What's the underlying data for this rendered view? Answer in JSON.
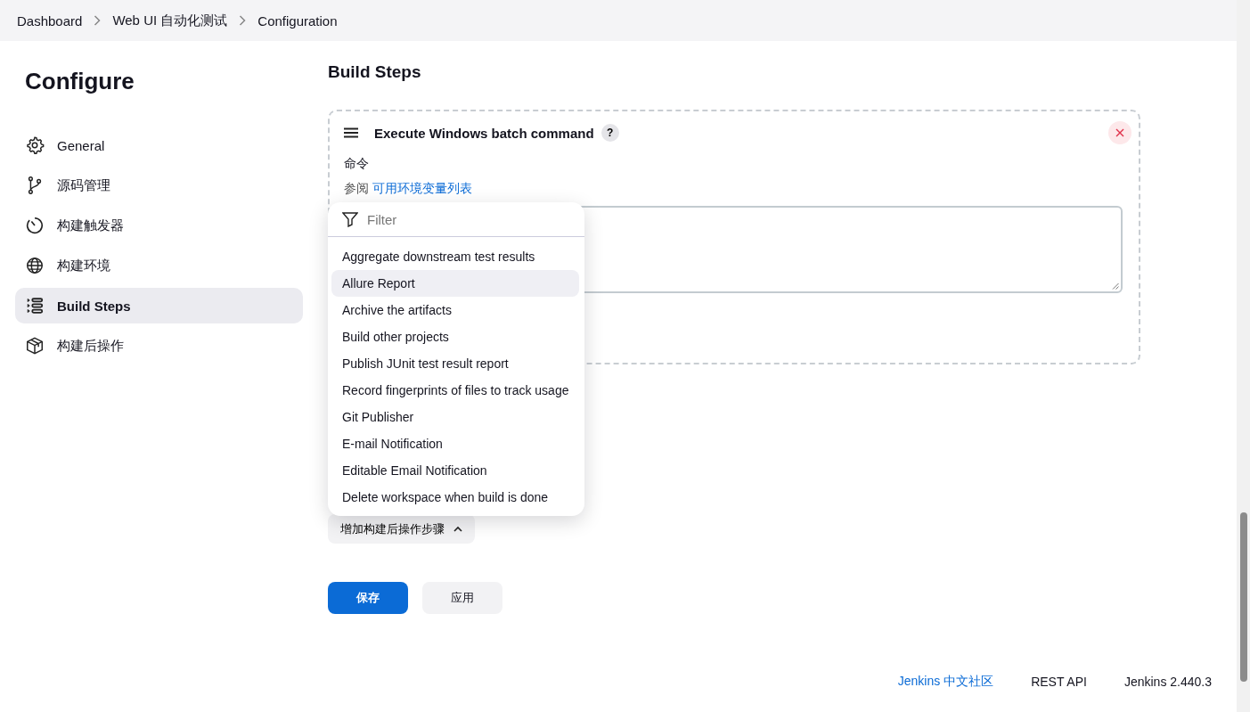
{
  "breadcrumbs": [
    {
      "label": "Dashboard"
    },
    {
      "label": "Web UI 自动化测试"
    },
    {
      "label": "Configuration"
    }
  ],
  "sidebar": {
    "title": "Configure",
    "items": [
      {
        "label": "General",
        "kind": "gear",
        "selected": false
      },
      {
        "label": "源码管理",
        "kind": "branch",
        "selected": false
      },
      {
        "label": "构建触发器",
        "kind": "timer",
        "selected": false
      },
      {
        "label": "构建环境",
        "kind": "globe",
        "selected": false
      },
      {
        "label": "Build Steps",
        "kind": "steps",
        "selected": true
      },
      {
        "label": "构建后操作",
        "kind": "box",
        "selected": false
      }
    ]
  },
  "build_steps": {
    "heading": "Build Steps",
    "step": {
      "title": "Execute Windows batch command",
      "help": "?",
      "command_label": "命令",
      "env_prefix": "参阅",
      "env_link": "可用环境变量列表"
    }
  },
  "post_build": {
    "add_button": "增加构建后操作步骤",
    "expanded": true
  },
  "dropdown": {
    "placeholder": "Filter",
    "items": [
      {
        "label": "Aggregate downstream test results",
        "selected": false
      },
      {
        "label": "Allure Report",
        "selected": true
      },
      {
        "label": "Archive the artifacts",
        "selected": false
      },
      {
        "label": "Build other projects",
        "selected": false
      },
      {
        "label": "Publish JUnit test result report",
        "selected": false
      },
      {
        "label": "Record fingerprints of files to track usage",
        "selected": false
      },
      {
        "label": "Git Publisher",
        "selected": false
      },
      {
        "label": "E-mail Notification",
        "selected": false
      },
      {
        "label": "Editable Email Notification",
        "selected": false
      },
      {
        "label": "Delete workspace when build is done",
        "selected": false
      }
    ]
  },
  "buttons": [
    {
      "label": "保存",
      "kind": "primary"
    },
    {
      "label": "应用",
      "kind": "secondary"
    }
  ],
  "footer": {
    "links": [
      {
        "label": "Jenkins 中文社区",
        "kind": "link"
      },
      {
        "label": "REST API",
        "kind": "plain"
      },
      {
        "label": "Jenkins 2.440.3",
        "kind": "plain"
      }
    ]
  }
}
